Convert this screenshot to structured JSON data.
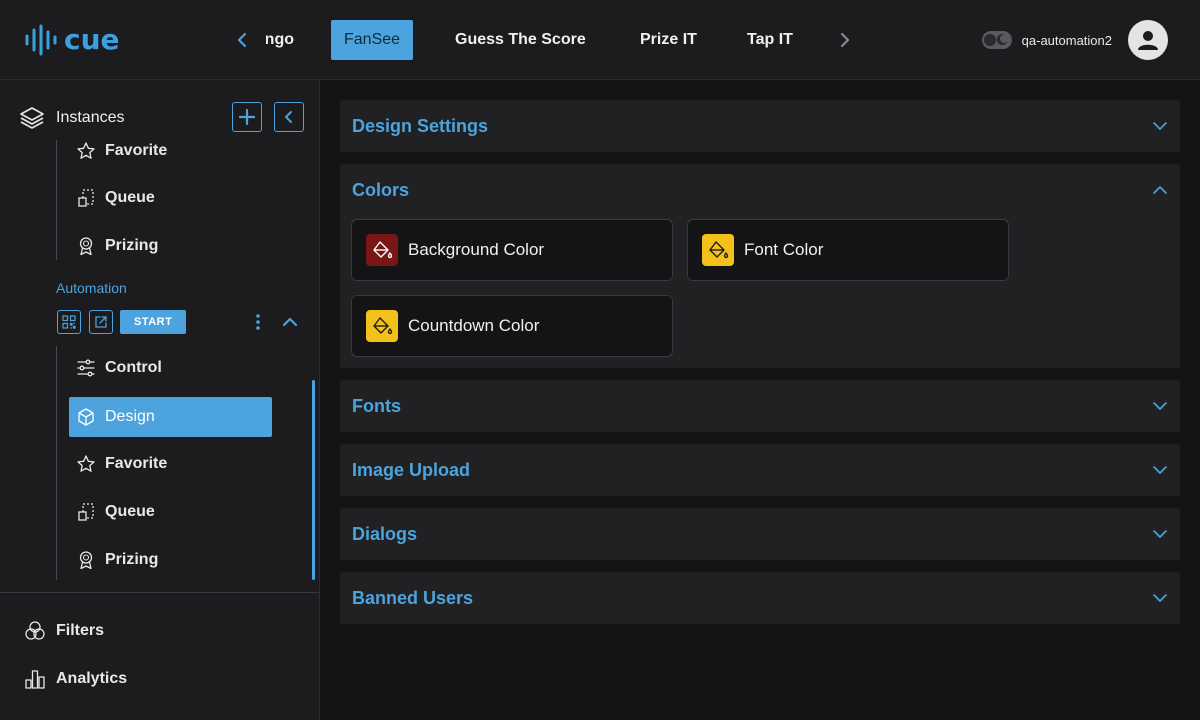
{
  "app": {
    "logo_text": "cue"
  },
  "header": {
    "tabs": [
      {
        "label": "ngo"
      },
      {
        "label": "FanSee"
      },
      {
        "label": "Guess The Score"
      },
      {
        "label": "Prize IT"
      },
      {
        "label": "Tap IT"
      }
    ],
    "active_tab": "FanSee",
    "username": "qa-automation2"
  },
  "sidebar": {
    "title": "Instances",
    "partial_item": {
      "label": "Favorite",
      "icon": "star-icon"
    },
    "upper_items": [
      {
        "label": "Queue",
        "icon": "queue-icon"
      },
      {
        "label": "Prizing",
        "icon": "award-icon"
      }
    ],
    "group": {
      "label": "Automation",
      "start_label": "START",
      "items": [
        {
          "label": "Control",
          "icon": "sliders-icon"
        },
        {
          "label": "Design",
          "icon": "design-icon",
          "active": true
        },
        {
          "label": "Favorite",
          "icon": "star-icon"
        },
        {
          "label": "Queue",
          "icon": "queue-icon"
        },
        {
          "label": "Prizing",
          "icon": "award-icon"
        }
      ]
    },
    "bottom_items": [
      {
        "label": "Filters",
        "icon": "filters-icon"
      },
      {
        "label": "Analytics",
        "icon": "analytics-icon"
      }
    ]
  },
  "main": {
    "sections": [
      {
        "title": "Design Settings",
        "expanded": false
      },
      {
        "title": "Colors",
        "expanded": true
      },
      {
        "title": "Fonts",
        "expanded": false
      },
      {
        "title": "Image Upload",
        "expanded": false
      },
      {
        "title": "Dialogs",
        "expanded": false
      },
      {
        "title": "Banned Users",
        "expanded": false
      }
    ],
    "colors": [
      {
        "label": "Background Color",
        "swatch": "#7a1616"
      },
      {
        "label": "Font Color",
        "swatch": "#f3c21a"
      },
      {
        "label": "Countdown Color",
        "swatch": "#f3c21a"
      }
    ]
  },
  "theme": {
    "accent": "#4ca3dd",
    "background": "#141416",
    "surface": "#1c1c1e",
    "panel": "#212123"
  }
}
